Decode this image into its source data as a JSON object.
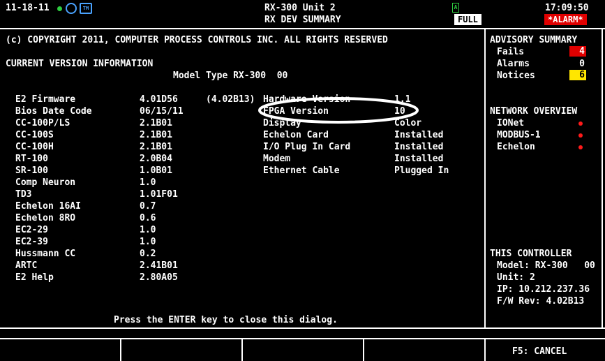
{
  "header": {
    "date": "11-18-11",
    "title": "RX-300 Unit 2",
    "subtitle": "RX DEV SUMMARY",
    "view_mode": "FULL",
    "time": "17:09:50",
    "alarm": "*ALARM*"
  },
  "dialog": {
    "copyright": "(c) COPYRIGHT 2011, COMPUTER PROCESS CONTROLS INC. ALL RIGHTS RESERVED",
    "section_title": "CURRENT VERSION INFORMATION",
    "model_line": "Model Type RX-300  00",
    "left_rows": [
      {
        "label": "E2 Firmware",
        "value": "4.01D56"
      },
      {
        "label": "Bios Date Code",
        "value": "06/15/11"
      },
      {
        "label": "CC-100P/LS",
        "value": "2.1B01"
      },
      {
        "label": "CC-100S",
        "value": "2.1B01"
      },
      {
        "label": "CC-100H",
        "value": "2.1B01"
      },
      {
        "label": "RT-100",
        "value": "2.0B04"
      },
      {
        "label": "SR-100",
        "value": "1.0B01"
      },
      {
        "label": "Comp Neuron",
        "value": "1.0"
      },
      {
        "label": "TD3",
        "value": "1.01F01"
      },
      {
        "label": "Echelon 16AI",
        "value": "0.7"
      },
      {
        "label": "Echelon 8RO",
        "value": "0.6"
      },
      {
        "label": "EC2-29",
        "value": "1.0"
      },
      {
        "label": "EC2-39",
        "value": "1.0"
      },
      {
        "label": "Hussmann CC",
        "value": "0.2"
      },
      {
        "label": "ARTC",
        "value": "2.41B01"
      },
      {
        "label": "E2 Help",
        "value": "2.80A05"
      }
    ],
    "extra_version": "(4.02B13)",
    "right_rows": [
      {
        "label": "Hardware Version",
        "value": "1.1"
      },
      {
        "label": "FPGA Version",
        "value": "10"
      },
      {
        "label": "Display",
        "value": "Color"
      },
      {
        "label": "Echelon Card",
        "value": "Installed"
      },
      {
        "label": "I/O Plug In Card",
        "value": "Installed"
      },
      {
        "label": "Modem",
        "value": "Installed"
      },
      {
        "label": "Ethernet Cable",
        "value": "Plugged In"
      }
    ],
    "footer_msg": "Press the ENTER key to close this dialog."
  },
  "advisory": {
    "title": "ADVISORY SUMMARY",
    "fails_label": "Fails",
    "fails_value": "4",
    "alarms_label": "Alarms",
    "alarms_value": "0",
    "notices_label": "Notices",
    "notices_value": "6"
  },
  "network": {
    "title": "NETWORK OVERVIEW",
    "items": [
      "IONet",
      "MODBUS-1",
      "Echelon"
    ]
  },
  "controller": {
    "title": "THIS CONTROLLER",
    "model": "Model: RX-300   00",
    "unit": "Unit: 2",
    "ip": "IP: 10.212.237.36",
    "fw": "F/W Rev: 4.02B13"
  },
  "fkeys": {
    "f5": "F5: CANCEL"
  },
  "colors": {
    "fails": "#e00000",
    "notices": "#ffe600",
    "status_dot": "#ff1a1a",
    "header_dot": "#2ecc40"
  }
}
